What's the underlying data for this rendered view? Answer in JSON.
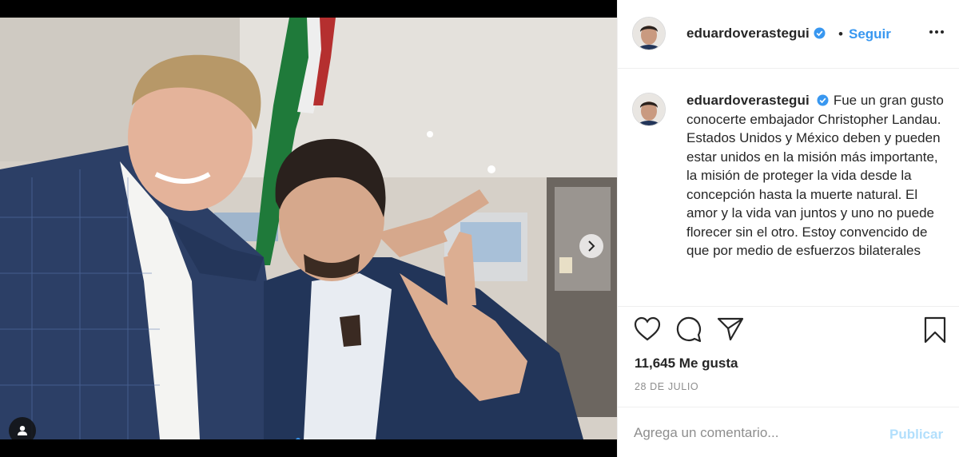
{
  "post": {
    "username": "eduardoverastegui",
    "follow_label": "Seguir",
    "separator": "•",
    "caption": "Fue un gran gusto conocerte embajador Christopher Landau.\nEstados Unidos y México deben y pueden estar unidos en la misión más importante, la misión de proteger la vida desde la concepción hasta la muerte natural. El amor y la vida van juntos y uno no puede florecer sin el otro. Estoy convencido de que por medio de esfuerzos bilaterales",
    "likes": "11,645 Me gusta",
    "date": "28 DE JULIO"
  },
  "comment": {
    "placeholder": "Agrega un comentario...",
    "publish_label": "Publicar"
  },
  "carousel": {
    "count": 2,
    "active_index": 0
  },
  "colors": {
    "accent": "#3897f0",
    "publish_disabled": "#b2dffc",
    "text": "#262626",
    "muted": "#8e8e8e",
    "border": "#efefef"
  },
  "icons": {
    "verified": "verified-badge-icon",
    "more": "more-options-icon",
    "like": "heart-icon",
    "comment": "comment-bubble-icon",
    "share": "paper-plane-icon",
    "save": "bookmark-icon",
    "next": "chevron-right-icon",
    "tag": "user-tag-icon"
  }
}
